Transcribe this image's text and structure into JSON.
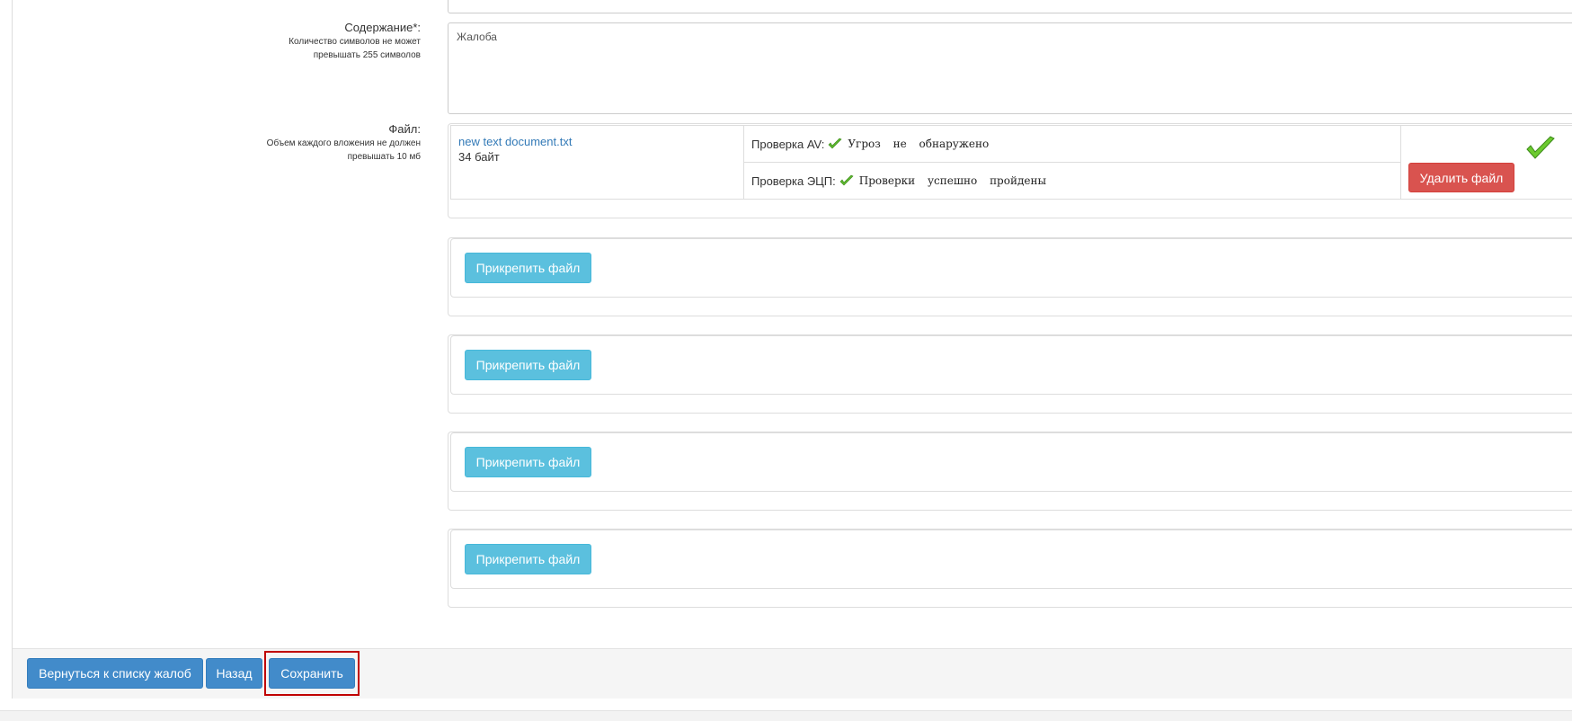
{
  "form": {
    "content": {
      "label": "Содержание*:",
      "hint_line1": "Количество символов не может",
      "hint_line2": "превышать 255 символов",
      "value": "Жалоба"
    },
    "file": {
      "label": "Файл:",
      "hint_line1": "Объем каждого вложения не должен",
      "hint_line2": "превышать 10 мб",
      "attached": {
        "name": "new text document.txt",
        "size": "34 байт",
        "av_check_label": "Проверка AV:",
        "av_check_result": "Угроз не обнаружено",
        "ecp_check_label": "Проверка ЭЦП:",
        "ecp_check_result": "Проверки успешно пройдены",
        "delete_label": "Удалить файл",
        "status_icon": "check-icon"
      },
      "attach_slots": [
        {
          "label": "Прикрепить файл"
        },
        {
          "label": "Прикрепить файл"
        },
        {
          "label": "Прикрепить файл"
        },
        {
          "label": "Прикрепить файл"
        }
      ]
    }
  },
  "footer": {
    "back_to_list_label": "Вернуться к списку жалоб",
    "back_label": "Назад",
    "save_label": "Сохранить"
  },
  "colors": {
    "primary": "#428bca",
    "info": "#5bc0de",
    "danger": "#d9534f",
    "link": "#337ab7",
    "highlight": "#c00000",
    "check_green": "#5cb82e"
  }
}
